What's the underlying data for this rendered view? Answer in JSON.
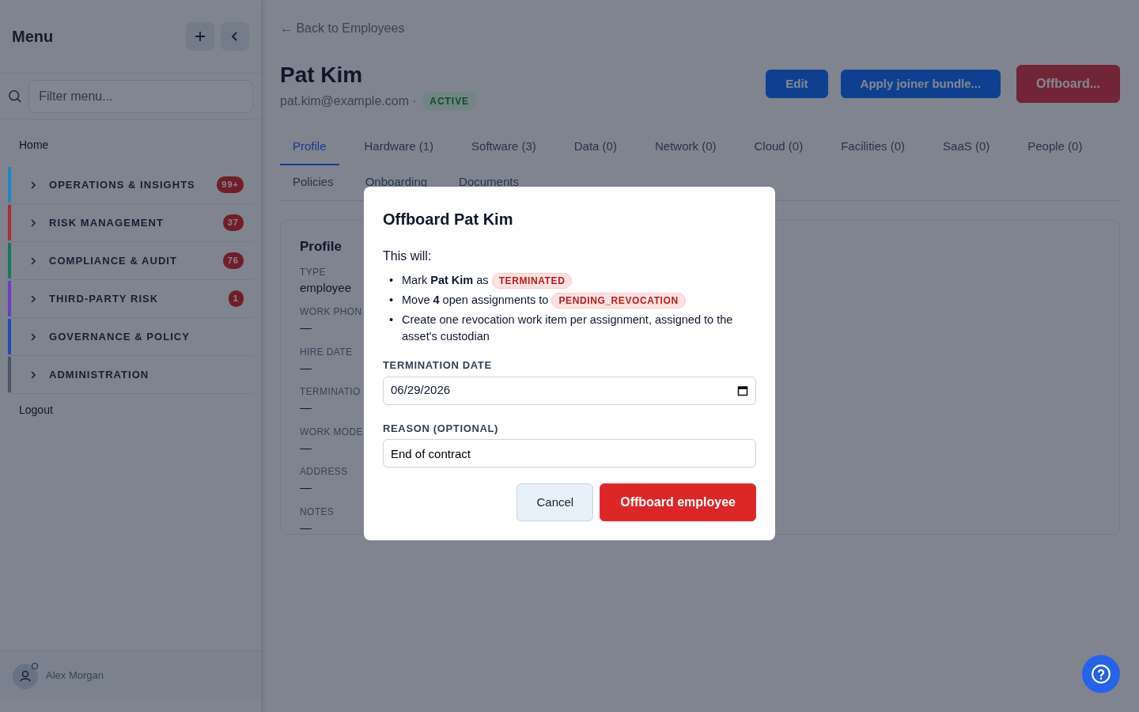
{
  "sidebar": {
    "title": "Menu",
    "filter": {
      "placeholder": "Filter menu..."
    },
    "top_link": "Home",
    "sections": [
      {
        "label": "OPERATIONS & INSIGHTS",
        "color": "#1e88c0",
        "badge": "99+",
        "expanded": false
      },
      {
        "label": "RISK MANAGEMENT",
        "color": "#b02a35",
        "badge": "37",
        "expanded": false
      },
      {
        "label": "COMPLIANCE & AUDIT",
        "color": "#137a5c",
        "badge": "76",
        "expanded": false
      },
      {
        "label": "THIRD-PARTY RISK",
        "color": "#6b3fc0",
        "badge": "1",
        "expanded": false
      },
      {
        "label": "GOVERNANCE & POLICY",
        "color": "#2649b5",
        "expanded": false
      },
      {
        "label": "ADMINISTRATION",
        "color": "#4b5467",
        "expanded": false
      }
    ],
    "bottom_link": "Logout",
    "user": "Alex Morgan"
  },
  "back_link": "← Back to Employees",
  "employee": {
    "name": "Pat Kim",
    "email": "pat.kim@example.com",
    "separator": "·",
    "status": "ACTIVE"
  },
  "actions": [
    {
      "label": "Edit",
      "kind": "primary"
    },
    {
      "label": "Apply joiner bundle...",
      "kind": "primary"
    },
    {
      "label": "Offboard...",
      "kind": "danger"
    }
  ],
  "tabs": [
    {
      "label": "Profile",
      "selected": true
    },
    {
      "label": "Hardware (1)",
      "selected": false
    },
    {
      "label": "Software (3)",
      "selected": false
    },
    {
      "label": "Data (0)",
      "selected": false
    },
    {
      "label": "Network (0)",
      "selected": false
    },
    {
      "label": "Cloud (0)",
      "selected": false
    },
    {
      "label": "Facilities (0)",
      "selected": false
    },
    {
      "label": "SaaS (0)",
      "selected": false
    },
    {
      "label": "People (0)",
      "selected": false
    },
    {
      "label": "Policies",
      "selected": false
    },
    {
      "label": "Onboarding",
      "selected": false
    },
    {
      "label": "Documents",
      "selected": false
    }
  ],
  "profile": {
    "title": "Profile",
    "fields": [
      {
        "label": "TYPE",
        "value": "employee"
      },
      {
        "label": "WORK PHON",
        "value": "—"
      },
      {
        "label": "HIRE DATE",
        "value": "—"
      },
      {
        "label": "TERMINATIO",
        "value": "—"
      },
      {
        "label": "WORK MODE",
        "value": "—"
      },
      {
        "label": "ADDRESS",
        "value": "—"
      },
      {
        "label": "NOTES",
        "value": "—"
      }
    ]
  },
  "dialog": {
    "title": "Offboard Pat Kim",
    "intro": "This will:",
    "steps": [
      {
        "marker": "•",
        "text": "Mark **Pat Kim** as",
        "tag": "TERMINATED"
      },
      {
        "marker": "•",
        "text": "Move **4** open assignments to",
        "tag": "PENDING_REVOCATION"
      },
      {
        "marker": "•",
        "text": "Create one revocation work item per assignment, assigned to the asset's custodian"
      }
    ],
    "date_label": "TERMINATION DATE",
    "date_value": "06/29/2026",
    "reason_label": "REASON (OPTIONAL)",
    "reason_value": "End of contract",
    "cancel": "Cancel",
    "confirm": "Offboard employee"
  }
}
